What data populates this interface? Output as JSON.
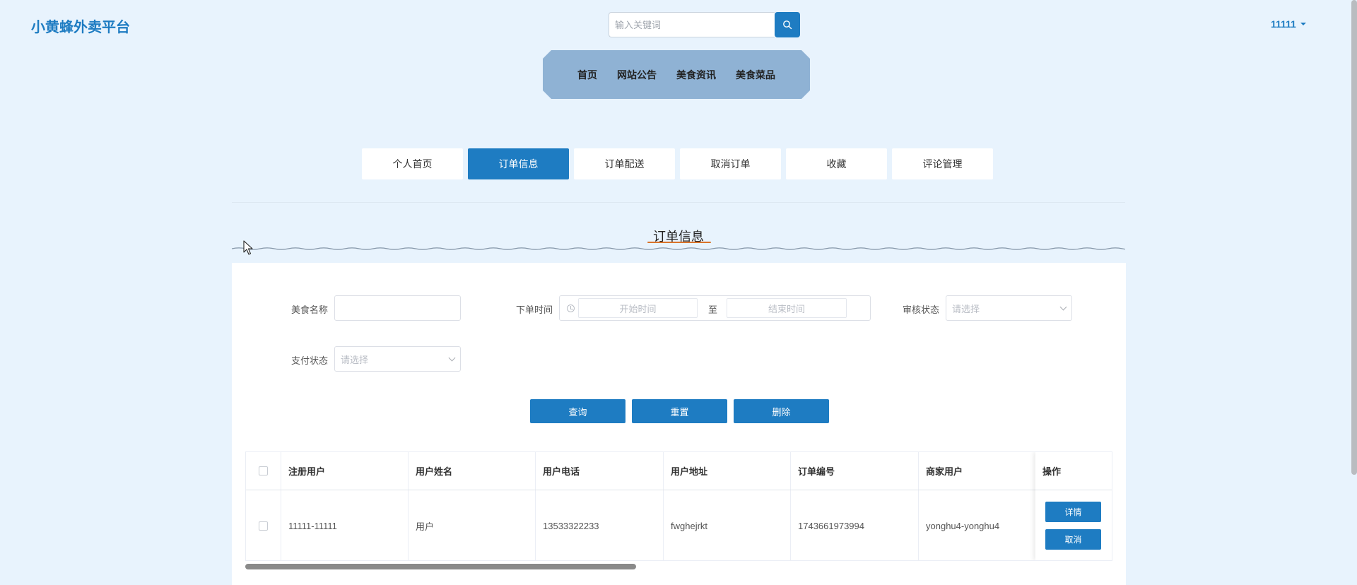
{
  "header": {
    "brand": "小黄蜂外卖平台",
    "search_placeholder": "输入关键词",
    "search_icon": "search-icon",
    "user": "11111"
  },
  "nav": {
    "items": [
      "首页",
      "网站公告",
      "美食资讯",
      "美食菜品"
    ]
  },
  "tabs": {
    "items": [
      "个人首页",
      "订单信息",
      "订单配送",
      "取消订单",
      "收藏",
      "评论管理"
    ],
    "active": "订单信息"
  },
  "section": {
    "title": "订单信息"
  },
  "filters": {
    "food_name_label": "美食名称",
    "order_time_label": "下单时间",
    "start_placeholder": "开始时间",
    "range_separator": "至",
    "end_placeholder": "结束时间",
    "review_label": "审核状态",
    "review_placeholder": "请选择",
    "pay_label": "支付状态",
    "pay_placeholder": "请选择"
  },
  "actions": {
    "query": "查询",
    "reset": "重置",
    "delete": "删除"
  },
  "table": {
    "columns": [
      "注册用户",
      "用户姓名",
      "用户电话",
      "用户地址",
      "订单编号",
      "商家用户"
    ],
    "ops_header": "操作",
    "rows": [
      {
        "cells": [
          "11111-11111",
          "用户",
          "13533322233",
          "fwghejrkt",
          "1743661973994",
          "yonghu4-yonghu4"
        ],
        "detail": "详情",
        "cancel": "取消"
      }
    ]
  },
  "colors": {
    "accent": "#1e7cc2",
    "background": "#e8f3fd",
    "nav_bg": "#8fb2d4"
  }
}
